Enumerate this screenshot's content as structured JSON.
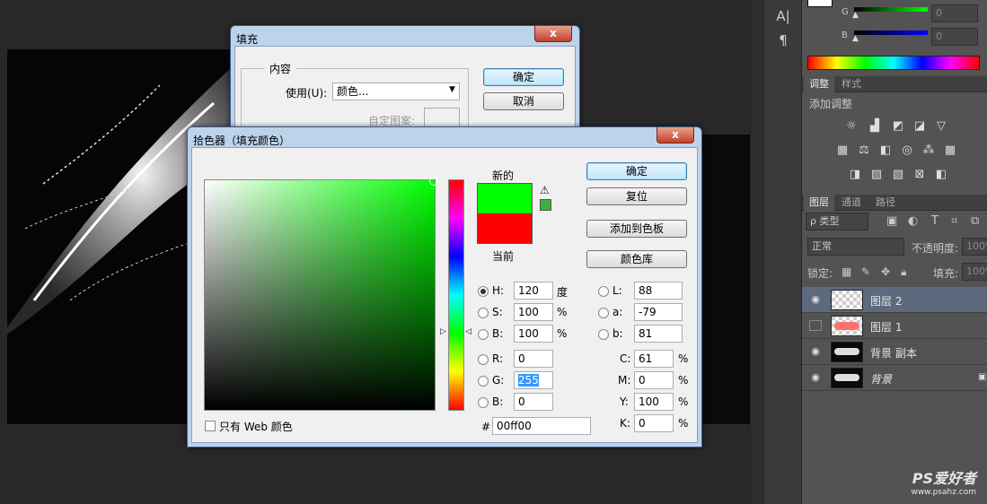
{
  "colors": {
    "accent_new": "#00ff00",
    "accent_old": "#ff0000",
    "dialog_chrome": "#bcd3ec",
    "workspace": "#282828",
    "panel": "#535353"
  },
  "fill_dialog": {
    "title": "填充",
    "group_label": "内容",
    "use_label": "使用(U):",
    "use_value": "颜色...",
    "ok": "确定",
    "cancel": "取消",
    "custom_pattern_label": "自定图案:"
  },
  "picker": {
    "title": "拾色器（填充颜色）",
    "close_glyph": "x",
    "new_label": "新的",
    "current_label": "当前",
    "buttons": {
      "ok": "确定",
      "reset": "复位",
      "add_swatch": "添加到色板",
      "libraries": "颜色库"
    },
    "hsb": [
      {
        "key": "H:",
        "value": "120",
        "unit": "度",
        "selected": true
      },
      {
        "key": "S:",
        "value": "100",
        "unit": "%",
        "selected": false
      },
      {
        "key": "B:",
        "value": "100",
        "unit": "%",
        "selected": false
      }
    ],
    "rgb": [
      {
        "key": "R:",
        "value": "0"
      },
      {
        "key": "G:",
        "value": "255"
      },
      {
        "key": "B:",
        "value": "0"
      }
    ],
    "lab": [
      {
        "key": "L:",
        "value": "88"
      },
      {
        "key": "a:",
        "value": "-79"
      },
      {
        "key": "b:",
        "value": "81"
      }
    ],
    "cmyk": [
      {
        "key": "C:",
        "value": "61",
        "unit": "%"
      },
      {
        "key": "M:",
        "value": "0",
        "unit": "%"
      },
      {
        "key": "Y:",
        "value": "100",
        "unit": "%"
      },
      {
        "key": "K:",
        "value": "0",
        "unit": "%"
      }
    ],
    "hex_label": "#",
    "hex_value": "00ff00",
    "web_only_label": "只有 Web 颜色",
    "warning_icon": "warning-triangle-icon"
  },
  "color_panel": {
    "g_label": "G",
    "b_label": "B",
    "g_value": "0",
    "b_value": "0"
  },
  "adjustments": {
    "tabs": [
      "调整",
      "样式"
    ],
    "title": "添加调整",
    "icons": [
      "brightness-icon",
      "levels-icon",
      "curves-icon",
      "exposure-icon",
      "vibrance-icon",
      "hue-saturation-icon",
      "color-balance-icon",
      "black-white-icon",
      "photo-filter-icon",
      "channel-mixer-icon",
      "color-lookup-icon",
      "invert-icon",
      "posterize-icon",
      "threshold-icon",
      "gradient-map-icon",
      "selective-color-icon"
    ]
  },
  "layers": {
    "tabs": [
      "图层",
      "通道",
      "路径"
    ],
    "kind_filter": "ρ 类型",
    "blend_mode": "正常",
    "opacity_label": "不透明度:",
    "opacity_value": "100%",
    "lock_label": "锁定:",
    "fill_label": "填充:",
    "fill_value": "100%",
    "items": [
      {
        "name": "图层 2",
        "visible": true,
        "selected": true
      },
      {
        "name": "图层 1",
        "visible": false,
        "selected": false
      },
      {
        "name": "背景 副本",
        "visible": true,
        "selected": false
      },
      {
        "name": "背景",
        "visible": true,
        "selected": false,
        "locked": true
      }
    ]
  },
  "watermark": {
    "brand": "PS爱好者",
    "url": "www.psahz.com"
  }
}
